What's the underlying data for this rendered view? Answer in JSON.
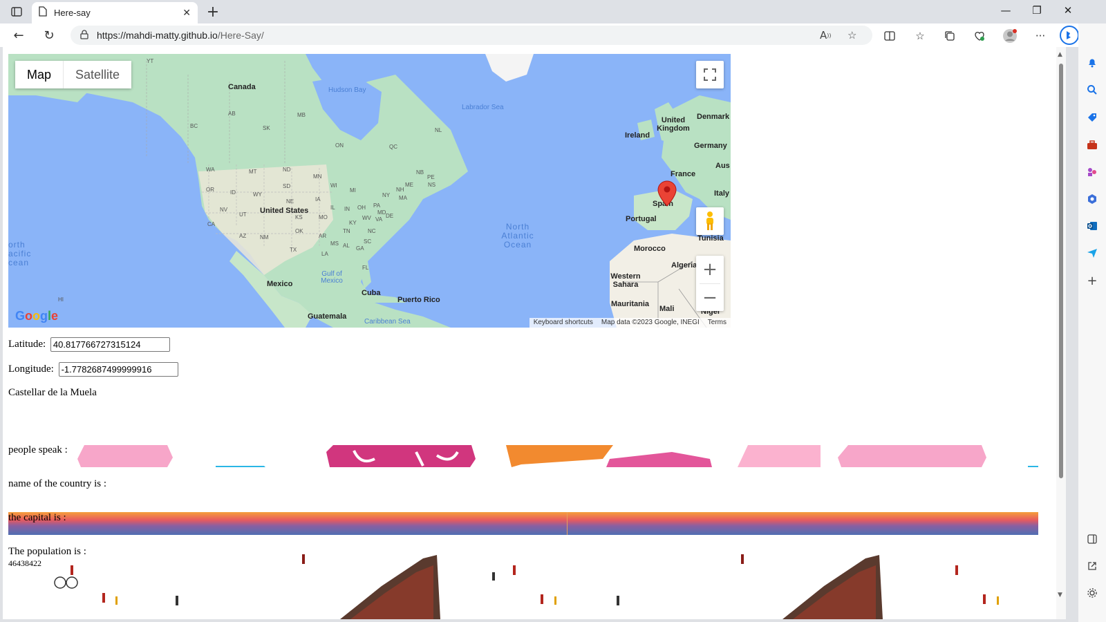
{
  "browser": {
    "tab_title": "Here-say",
    "url_host": "https://mahdi-matty.github.io",
    "url_path": "/Here-Say/"
  },
  "map": {
    "type_buttons": [
      "Map",
      "Satellite"
    ],
    "active_type": "Map",
    "logo": "Google",
    "footer": [
      "Keyboard shortcuts",
      "Map data ©2023 Google, INEGI",
      "Terms"
    ],
    "labels": {
      "canada": "Canada",
      "hudson_bay": "Hudson Bay",
      "labrador_sea": "Labrador Sea",
      "united_states": "United States",
      "mexico": "Mexico",
      "cuba": "Cuba",
      "puerto_rico": "Puerto Rico",
      "guatemala": "Guatemala",
      "caribbean_sea": "Caribbean Sea",
      "gulf_of_mexico": "Gulf of Mexico",
      "north_atlantic": "North Atlantic Ocean",
      "north_pacific": "orth acific cean",
      "ireland": "Ireland",
      "united_kingdom": "United Kingdom",
      "denmark": "Denmark",
      "germany": "Germany",
      "france": "France",
      "aus": "Aus",
      "italy": "Italy",
      "spain": "Spain",
      "portugal": "Portugal",
      "morocco": "Morocco",
      "tunisia": "Tunisia",
      "algeria": "Algeria",
      "western_sahara": "Western Sahara",
      "mauritania": "Mauritania",
      "mali": "Mali",
      "niger": "Niger",
      "hi": "HI",
      "yt": "YT",
      "bc": "BC",
      "ab": "AB",
      "sk": "SK",
      "mb": "MB",
      "on": "ON",
      "qc": "QC",
      "nl": "NL",
      "nb": "NB",
      "ns": "NS",
      "pe": "PE",
      "wa": "WA",
      "or": "OR",
      "ca": "CA",
      "nv": "NV",
      "id": "ID",
      "mt": "MT",
      "wy": "WY",
      "ut": "UT",
      "az": "AZ",
      "nm": "NM",
      "nd": "ND",
      "sd": "SD",
      "ne": "NE",
      "ks": "KS",
      "ok": "OK",
      "tx": "TX",
      "mn": "MN",
      "ia": "IA",
      "mo": "MO",
      "ar": "AR",
      "la": "LA",
      "wi": "WI",
      "il": "IL",
      "ms": "MS",
      "mi": "MI",
      "in": "IN",
      "ky": "KY",
      "tn": "TN",
      "al": "AL",
      "ga": "GA",
      "fl": "FL",
      "oh": "OH",
      "wv": "WV",
      "va": "VA",
      "nc": "NC",
      "sc": "SC",
      "pa": "PA",
      "ny": "NY",
      "me": "ME",
      "ma": "MA",
      "nh": "NH",
      "md": "MD",
      "de": "DE"
    }
  },
  "form": {
    "latitude_label": "Latitude:",
    "latitude_value": "40.817766727315124",
    "longitude_label": "Longitude:",
    "longitude_value": "-1.7782687499999916",
    "place_name": "Castellar de la Muela",
    "people_speak_label": "people speak :",
    "country_label": "name of the country is :",
    "capital_label": "the capital is :",
    "population_label": "The population is :",
    "population_value": "46438422"
  },
  "colors": {
    "water": "#8ab4f8",
    "land": "#b8e0c0",
    "land_dry": "#f2efe6",
    "marker": "#ea4335"
  }
}
